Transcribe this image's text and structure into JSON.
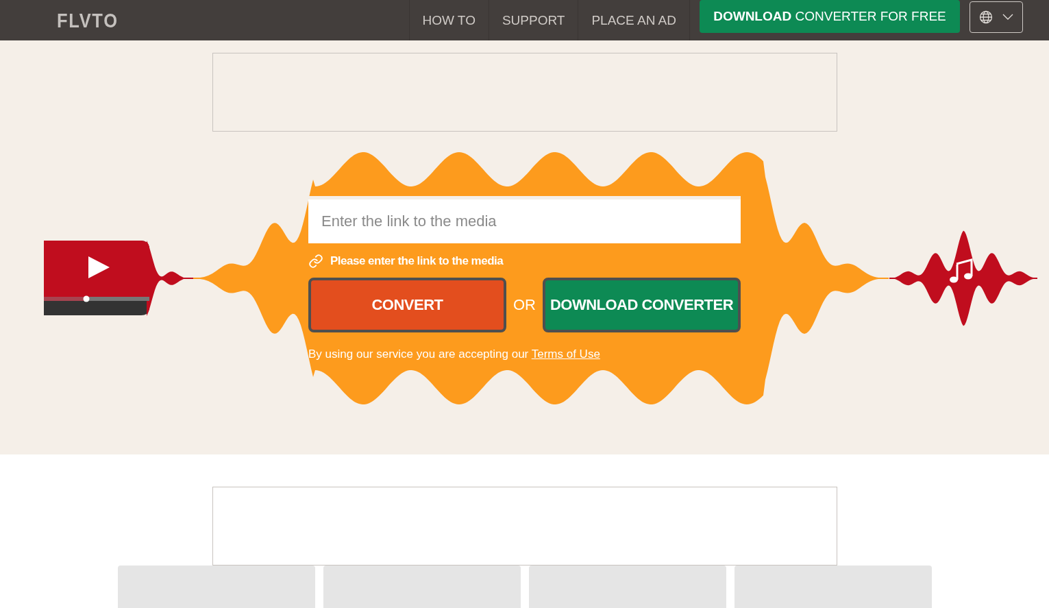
{
  "header": {
    "logo": "FLVTO",
    "nav": [
      "HOW TO",
      "SUPPORT",
      "PLACE AN AD"
    ],
    "download_button": "**DOWNLOAD** CONVERTER FOR FREE"
  },
  "converter": {
    "input": {
      "placeholder": "Enter the link to the media"
    },
    "hint": "Please enter the link to the media",
    "convert_button": "CONVERT",
    "or": "OR",
    "download_button": "DOWNLOAD CONVERTER",
    "terms": {
      "text": "By using our service you are accepting our",
      "link": "Terms of Use"
    }
  },
  "cards": [
    {
      "kind": "placeholder"
    },
    {
      "kind": "placeholder"
    },
    {
      "kind": "placeholder"
    },
    {
      "kind": "placeholder"
    }
  ]
}
